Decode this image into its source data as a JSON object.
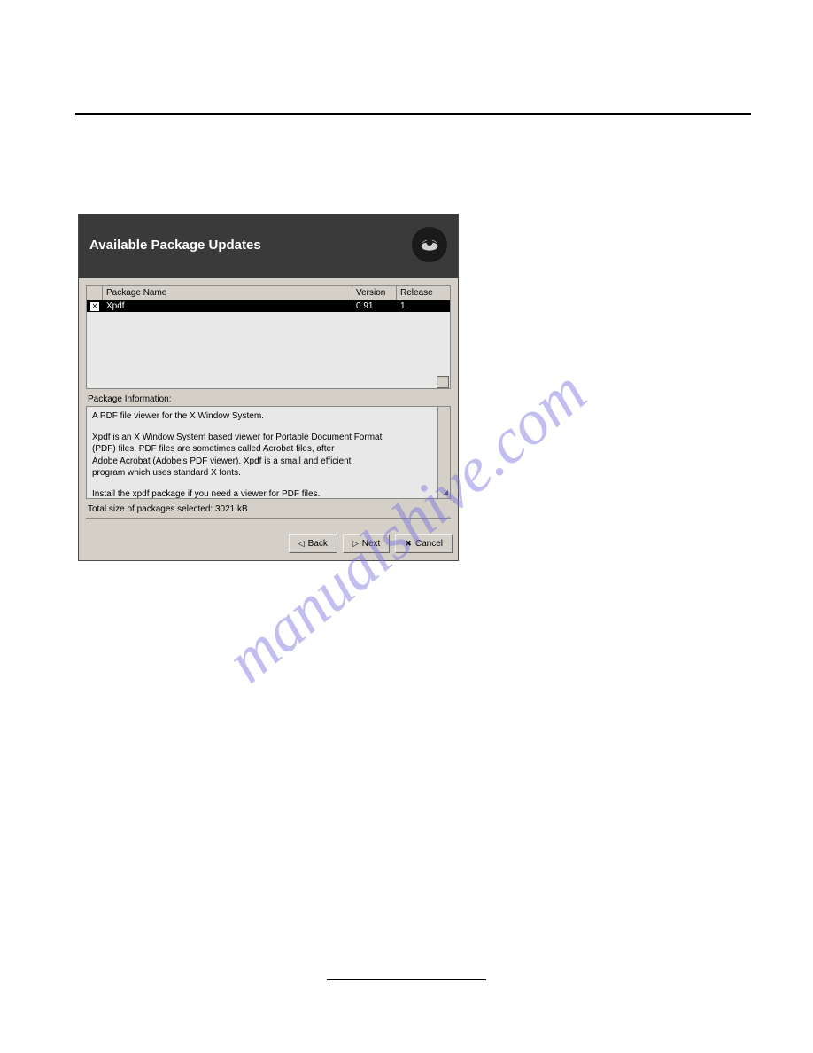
{
  "watermark": "manualshive.com",
  "dialog": {
    "title": "Available Package Updates",
    "icon": "redhat-icon",
    "table": {
      "headers": {
        "name": "Package Name",
        "version": "Version",
        "release": "Release"
      },
      "rows": [
        {
          "checked": true,
          "name": "Xpdf",
          "version": "0.91",
          "release": "1"
        }
      ]
    },
    "package_info_label": "Package Information:",
    "info_lines": {
      "l1": "A PDF file viewer for the X Window System.",
      "l2": "Xpdf is an X Window System based viewer for Portable Document Format",
      "l3": "(PDF) files.  PDF files are sometimes called Acrobat files, after",
      "l4": "Adobe Acrobat (Adobe's PDF viewer).  Xpdf is a small and efficient",
      "l5": "program which uses standard X fonts.",
      "l6": "Install the xpdf package if you need a viewer for PDF files."
    },
    "total_size": "Total size of packages selected: 3021 kB",
    "buttons": {
      "back": "Back",
      "next": "Next",
      "cancel": "Cancel"
    }
  }
}
